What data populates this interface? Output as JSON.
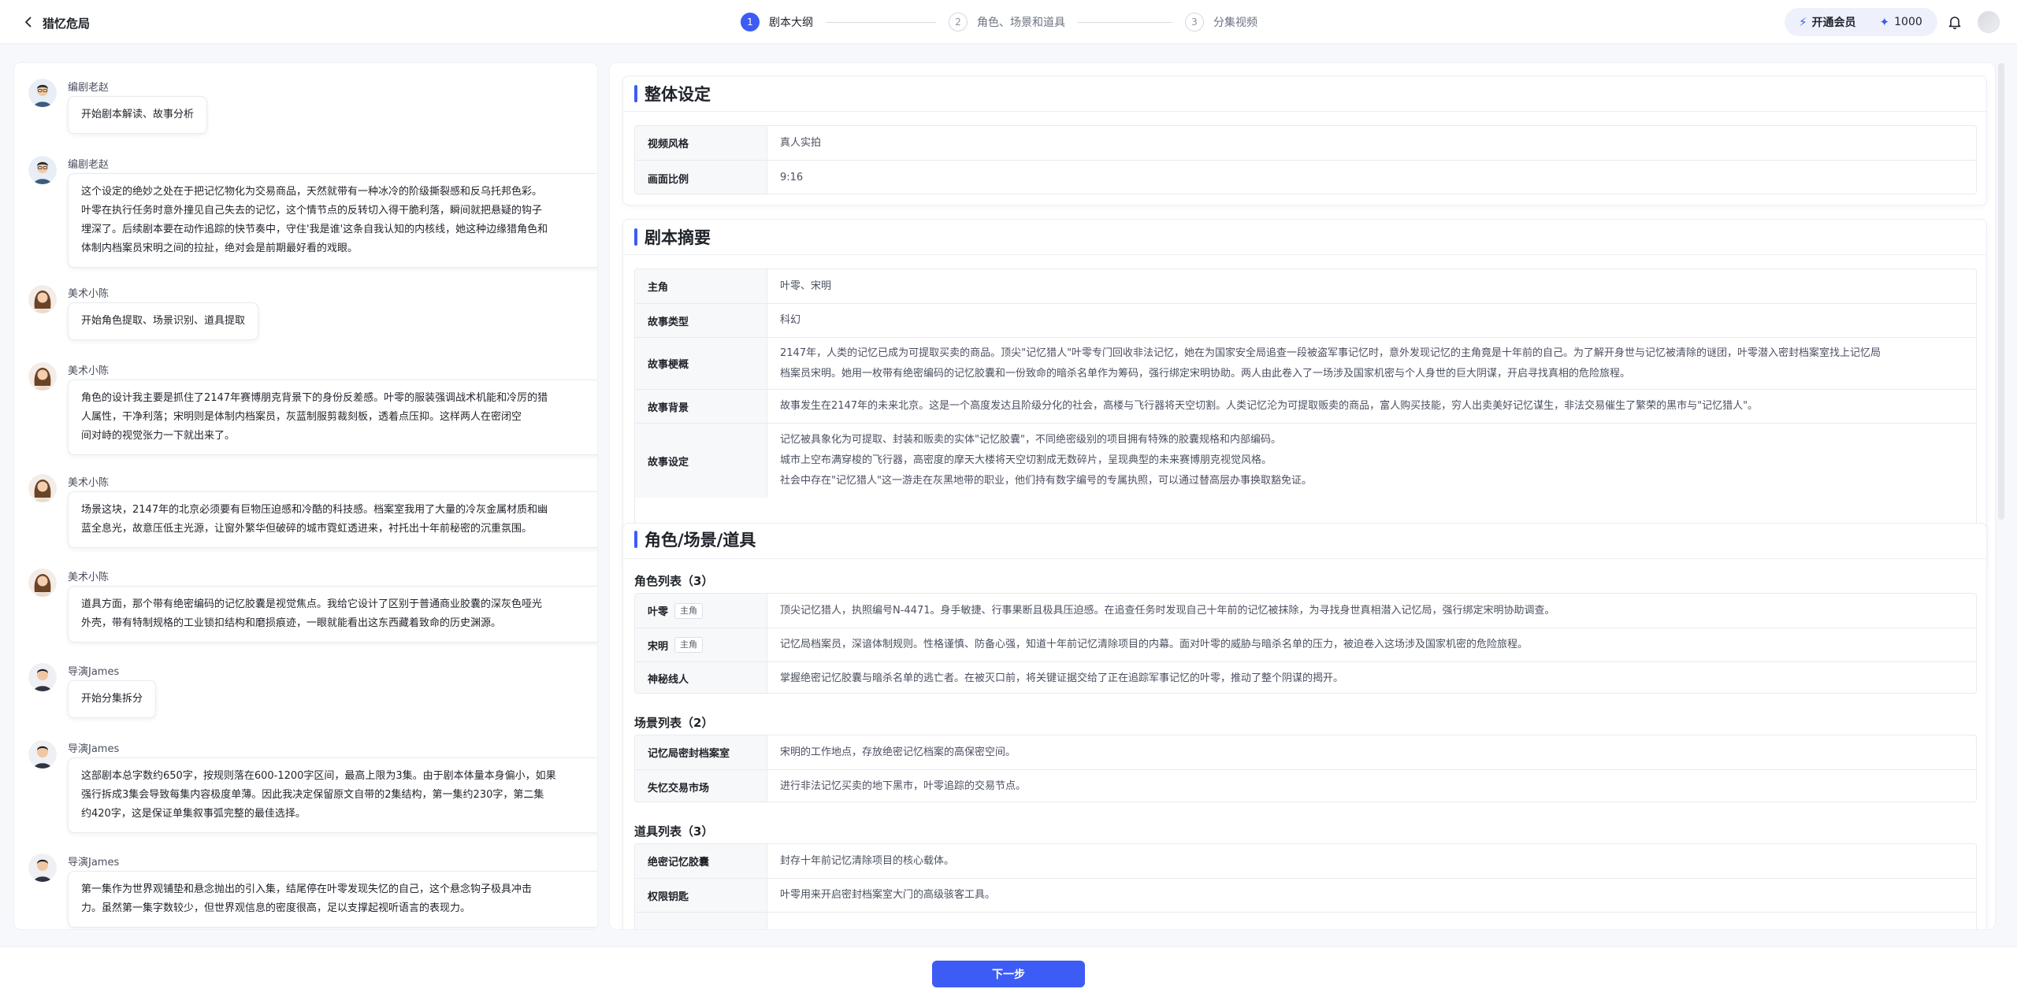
{
  "header": {
    "title": "猎忆危局",
    "steps": [
      {
        "num": "1",
        "label": "剧本大纲"
      },
      {
        "num": "2",
        "label": "角色、场景和道具"
      },
      {
        "num": "3",
        "label": "分集视频"
      }
    ],
    "vip_label": "开通会员",
    "credits": "1000",
    "icons": {
      "back": "chevron-left-icon",
      "vip": "lightning-icon",
      "credits": "sparkle-icon",
      "bell": "bell-icon"
    },
    "accent": "#3c5cf5"
  },
  "chat": [
    {
      "name": "编剧老赵",
      "avatar": "male-avatar",
      "text": "开始剧本解读、故事分析"
    },
    {
      "name": "编剧老赵",
      "avatar": "male-avatar",
      "lines": [
        "这个设定的绝妙之处在于把记忆物化为交易商品，天然就带有一种冰冷的阶级撕裂感和反乌托邦色彩。",
        "叶零在执行任务时意外撞见自己失去的记忆，这个情节点的反转切入得干脆利落，瞬间就把悬疑的钩子",
        "埋深了。后续剧本要在动作追踪的快节奏中，守住'我是谁'这条自我认知的内核线，她这种边缘猎角色和",
        "体制内档案员宋明之间的拉扯，绝对会是前期最好看的戏眼。"
      ]
    },
    {
      "name": "美术小陈",
      "avatar": "female-avatar",
      "text": "开始角色提取、场景识别、道具提取"
    },
    {
      "name": "美术小陈",
      "avatar": "female-avatar",
      "lines": [
        "角色的设计我主要是抓住了2147年赛博朋克背景下的身份反差感。叶零的服装强调战术机能和冷厉的猎",
        "人属性，干净利落；宋明则是体制内档案员，灰蓝制服剪裁刻板，透着点压抑。这样两人在密闭空",
        "间对峙的视觉张力一下就出来了。"
      ]
    },
    {
      "name": "美术小陈",
      "avatar": "female-avatar",
      "lines": [
        "场景这块，2147年的北京必须要有巨物压迫感和冷酷的科技感。档案室我用了大量的冷灰金属材质和幽",
        "蓝全息光，故意压低主光源，让窗外繁华但破碎的城市霓虹透进来，衬托出十年前秘密的沉重氛围。"
      ]
    },
    {
      "name": "美术小陈",
      "avatar": "female-avatar",
      "lines": [
        "道具方面，那个带有绝密编码的记忆胶囊是视觉焦点。我给它设计了区别于普通商业胶囊的深灰色哑光",
        "外壳，带有特制规格的工业锁扣结构和磨损痕迹，一眼就能看出这东西藏着致命的历史渊源。"
      ]
    },
    {
      "name": "导演James",
      "avatar": "director-avatar",
      "text": "开始分集拆分"
    },
    {
      "name": "导演James",
      "avatar": "director-avatar",
      "lines": [
        "这部剧本总字数约650字，按规则落在600-1200字区间，最高上限为3集。由于剧本体量本身偏小，如果",
        "强行拆成3集会导致每集内容极度单薄。因此我决定保留原文自带的2集结构，第一集约230字，第二集",
        "约420字，这是保证单集叙事弧完整的最佳选择。"
      ]
    },
    {
      "name": "导演James",
      "avatar": "director-avatar",
      "lines": [
        "第一集作为世界观铺垫和悬念抛出的引入集，结尾停在叶零发现失忆的自己，这个悬念钩子极具冲击",
        "力。虽然第一集字数较少，但世界观信息的密度很高，足以支撑起视听语言的表现力。"
      ]
    }
  ],
  "overall": {
    "title": "整体设定",
    "rows": [
      {
        "key": "视频风格",
        "value": "真人实拍"
      },
      {
        "key": "画面比例",
        "value": "9:16"
      }
    ]
  },
  "summary": {
    "title": "剧本摘要",
    "rows": [
      {
        "key": "主角",
        "lines": [
          "叶零、宋明"
        ]
      },
      {
        "key": "故事类型",
        "lines": [
          "科幻"
        ]
      },
      {
        "key": "故事梗概",
        "lines": [
          "2147年，人类的记忆已成为可提取买卖的商品。顶尖\"记忆猎人\"叶零专门回收非法记忆，她在为国家安全局追查一段被盗军事记忆时，意外发现记忆的主角竟是十年前的自己。为了解开身世与记忆被清除的谜团，叶零潜入密封档案室找上记忆局",
          "档案员宋明。她用一枚带有绝密编码的记忆胶囊和一份致命的暗杀名单作为筹码，强行绑定宋明协助。两人由此卷入了一场涉及国家机密与个人身世的巨大阴谋，开启寻找真相的危险旅程。"
        ]
      },
      {
        "key": "故事背景",
        "lines": [
          "故事发生在2147年的未来北京。这是一个高度发达且阶级分化的社会，高楼与飞行器将天空切割。人类记忆沦为可提取贩卖的商品，富人购买技能，穷人出卖美好记忆谋生，非法交易催生了繁荣的黑市与\"记忆猎人\"。"
        ]
      },
      {
        "key": "故事设定",
        "lines": [
          "记忆被具象化为可提取、封装和贩卖的实体\"记忆胶囊\"，不同绝密级别的项目拥有特殊的胶囊规格和内部编码。",
          "城市上空布满穿梭的飞行器，高密度的摩天大楼将天空切割成无数碎片，呈现典型的未来赛博朋克视觉风格。",
          "社会中存在\"记忆猎人\"这一游走在灰黑地带的职业，他们持有数字编号的专属执照，可以通过替高层办事换取豁免证。"
        ]
      }
    ]
  },
  "assets": {
    "title": "角色/场景/道具",
    "characters_heading": "角色列表（3）",
    "characters": [
      {
        "name": "叶零",
        "tag": "主角",
        "desc": "顶尖记忆猎人，执照编号N-4471。身手敏捷、行事果断且极具压迫感。在追查任务时发现自己十年前的记忆被抹除，为寻找身世真相潜入记忆局，强行绑定宋明协助调查。"
      },
      {
        "name": "宋明",
        "tag": "主角",
        "desc": "记忆局档案员，深谙体制规则。性格谨慎、防备心强，知道十年前记忆清除项目的内幕。面对叶零的威胁与暗杀名单的压力，被迫卷入这场涉及国家机密的危险旅程。"
      },
      {
        "name": "神秘线人",
        "tag": "",
        "desc": "掌握绝密记忆胶囊与暗杀名单的逃亡者。在被灭口前，将关键证据交给了正在追踪军事记忆的叶零，推动了整个阴谋的揭开。"
      }
    ],
    "scenes_heading": "场景列表（2）",
    "scenes": [
      {
        "name": "记忆局密封档案室",
        "desc": "宋明的工作地点，存放绝密记忆档案的高保密空间。"
      },
      {
        "name": "失忆交易市场",
        "desc": "进行非法记忆买卖的地下黑市，叶零追踪的交易节点。"
      }
    ],
    "props_heading": "道具列表（3）",
    "props": [
      {
        "name": "绝密记忆胶囊",
        "desc": "封存十年前记忆清除项目的核心载体。"
      },
      {
        "name": "权限钥匙",
        "desc": "叶零用来开启密封档案室大门的高级骇客工具。"
      }
    ]
  },
  "footer": {
    "next_label": "下一步"
  }
}
